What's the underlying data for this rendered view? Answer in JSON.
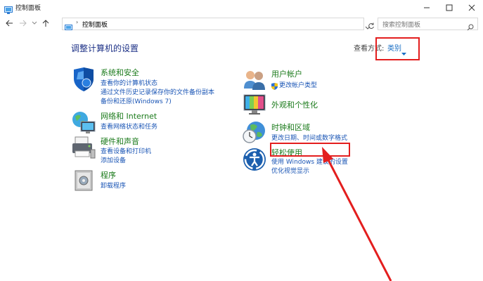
{
  "window": {
    "title": "控制面板",
    "accent": "#1e3287"
  },
  "address": {
    "separator": "›",
    "path": "控制面板",
    "search_placeholder": "搜索控制面板"
  },
  "main": {
    "heading": "调整计算机的设置",
    "view_by_label": "查看方式:",
    "view_by_value": "类别"
  },
  "categories": {
    "system_security": {
      "title": "系统和安全",
      "links": [
        "查看你的计算机状态",
        "通过文件历史记录保存你的文件备份副本",
        "备份和还原(Windows 7)"
      ],
      "icon": "shield-icon"
    },
    "network": {
      "title": "网络和 Internet",
      "links": [
        "查看网络状态和任务"
      ],
      "icon": "network-globe-icon"
    },
    "hardware": {
      "title": "硬件和声音",
      "links": [
        "查看设备和打印机",
        "添加设备"
      ],
      "icon": "printer-icon"
    },
    "programs": {
      "title": "程序",
      "links": [
        "卸载程序"
      ],
      "icon": "programs-box-icon"
    },
    "user_accounts": {
      "title": "用户帐户",
      "links": [
        "更改帐户类型"
      ],
      "icon": "users-icon"
    },
    "appearance": {
      "title": "外观和个性化",
      "icon": "monitor-icon"
    },
    "clock_region": {
      "title": "时钟和区域",
      "links": [
        "更改日期、时间或数字格式"
      ],
      "icon": "clock-globe-icon"
    },
    "ease_of_access": {
      "title": "轻松使用",
      "links": [
        "使用 Windows 建议的设置",
        "优化视觉显示"
      ],
      "icon": "ease-of-access-icon"
    }
  },
  "colors": {
    "annotation_red": "#e31e1e",
    "category_green": "#1a7a1a",
    "link_blue": "#1a55b5"
  }
}
